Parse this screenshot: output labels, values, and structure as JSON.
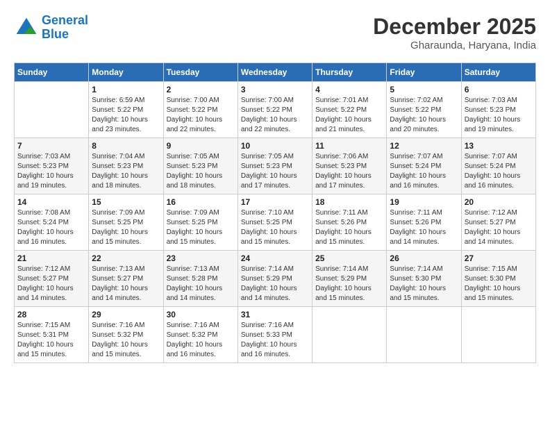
{
  "logo": {
    "line1": "General",
    "line2": "Blue"
  },
  "header": {
    "month_year": "December 2025",
    "location": "Gharaunda, Haryana, India"
  },
  "weekdays": [
    "Sunday",
    "Monday",
    "Tuesday",
    "Wednesday",
    "Thursday",
    "Friday",
    "Saturday"
  ],
  "weeks": [
    [
      {
        "day": "",
        "info": ""
      },
      {
        "day": "1",
        "info": "Sunrise: 6:59 AM\nSunset: 5:22 PM\nDaylight: 10 hours\nand 23 minutes."
      },
      {
        "day": "2",
        "info": "Sunrise: 7:00 AM\nSunset: 5:22 PM\nDaylight: 10 hours\nand 22 minutes."
      },
      {
        "day": "3",
        "info": "Sunrise: 7:00 AM\nSunset: 5:22 PM\nDaylight: 10 hours\nand 22 minutes."
      },
      {
        "day": "4",
        "info": "Sunrise: 7:01 AM\nSunset: 5:22 PM\nDaylight: 10 hours\nand 21 minutes."
      },
      {
        "day": "5",
        "info": "Sunrise: 7:02 AM\nSunset: 5:22 PM\nDaylight: 10 hours\nand 20 minutes."
      },
      {
        "day": "6",
        "info": "Sunrise: 7:03 AM\nSunset: 5:23 PM\nDaylight: 10 hours\nand 19 minutes."
      }
    ],
    [
      {
        "day": "7",
        "info": "Sunrise: 7:03 AM\nSunset: 5:23 PM\nDaylight: 10 hours\nand 19 minutes."
      },
      {
        "day": "8",
        "info": "Sunrise: 7:04 AM\nSunset: 5:23 PM\nDaylight: 10 hours\nand 18 minutes."
      },
      {
        "day": "9",
        "info": "Sunrise: 7:05 AM\nSunset: 5:23 PM\nDaylight: 10 hours\nand 18 minutes."
      },
      {
        "day": "10",
        "info": "Sunrise: 7:05 AM\nSunset: 5:23 PM\nDaylight: 10 hours\nand 17 minutes."
      },
      {
        "day": "11",
        "info": "Sunrise: 7:06 AM\nSunset: 5:23 PM\nDaylight: 10 hours\nand 17 minutes."
      },
      {
        "day": "12",
        "info": "Sunrise: 7:07 AM\nSunset: 5:24 PM\nDaylight: 10 hours\nand 16 minutes."
      },
      {
        "day": "13",
        "info": "Sunrise: 7:07 AM\nSunset: 5:24 PM\nDaylight: 10 hours\nand 16 minutes."
      }
    ],
    [
      {
        "day": "14",
        "info": "Sunrise: 7:08 AM\nSunset: 5:24 PM\nDaylight: 10 hours\nand 16 minutes."
      },
      {
        "day": "15",
        "info": "Sunrise: 7:09 AM\nSunset: 5:25 PM\nDaylight: 10 hours\nand 15 minutes."
      },
      {
        "day": "16",
        "info": "Sunrise: 7:09 AM\nSunset: 5:25 PM\nDaylight: 10 hours\nand 15 minutes."
      },
      {
        "day": "17",
        "info": "Sunrise: 7:10 AM\nSunset: 5:25 PM\nDaylight: 10 hours\nand 15 minutes."
      },
      {
        "day": "18",
        "info": "Sunrise: 7:11 AM\nSunset: 5:26 PM\nDaylight: 10 hours\nand 15 minutes."
      },
      {
        "day": "19",
        "info": "Sunrise: 7:11 AM\nSunset: 5:26 PM\nDaylight: 10 hours\nand 14 minutes."
      },
      {
        "day": "20",
        "info": "Sunrise: 7:12 AM\nSunset: 5:27 PM\nDaylight: 10 hours\nand 14 minutes."
      }
    ],
    [
      {
        "day": "21",
        "info": "Sunrise: 7:12 AM\nSunset: 5:27 PM\nDaylight: 10 hours\nand 14 minutes."
      },
      {
        "day": "22",
        "info": "Sunrise: 7:13 AM\nSunset: 5:27 PM\nDaylight: 10 hours\nand 14 minutes."
      },
      {
        "day": "23",
        "info": "Sunrise: 7:13 AM\nSunset: 5:28 PM\nDaylight: 10 hours\nand 14 minutes."
      },
      {
        "day": "24",
        "info": "Sunrise: 7:14 AM\nSunset: 5:29 PM\nDaylight: 10 hours\nand 14 minutes."
      },
      {
        "day": "25",
        "info": "Sunrise: 7:14 AM\nSunset: 5:29 PM\nDaylight: 10 hours\nand 15 minutes."
      },
      {
        "day": "26",
        "info": "Sunrise: 7:14 AM\nSunset: 5:30 PM\nDaylight: 10 hours\nand 15 minutes."
      },
      {
        "day": "27",
        "info": "Sunrise: 7:15 AM\nSunset: 5:30 PM\nDaylight: 10 hours\nand 15 minutes."
      }
    ],
    [
      {
        "day": "28",
        "info": "Sunrise: 7:15 AM\nSunset: 5:31 PM\nDaylight: 10 hours\nand 15 minutes."
      },
      {
        "day": "29",
        "info": "Sunrise: 7:16 AM\nSunset: 5:32 PM\nDaylight: 10 hours\nand 15 minutes."
      },
      {
        "day": "30",
        "info": "Sunrise: 7:16 AM\nSunset: 5:32 PM\nDaylight: 10 hours\nand 16 minutes."
      },
      {
        "day": "31",
        "info": "Sunrise: 7:16 AM\nSunset: 5:33 PM\nDaylight: 10 hours\nand 16 minutes."
      },
      {
        "day": "",
        "info": ""
      },
      {
        "day": "",
        "info": ""
      },
      {
        "day": "",
        "info": ""
      }
    ]
  ]
}
